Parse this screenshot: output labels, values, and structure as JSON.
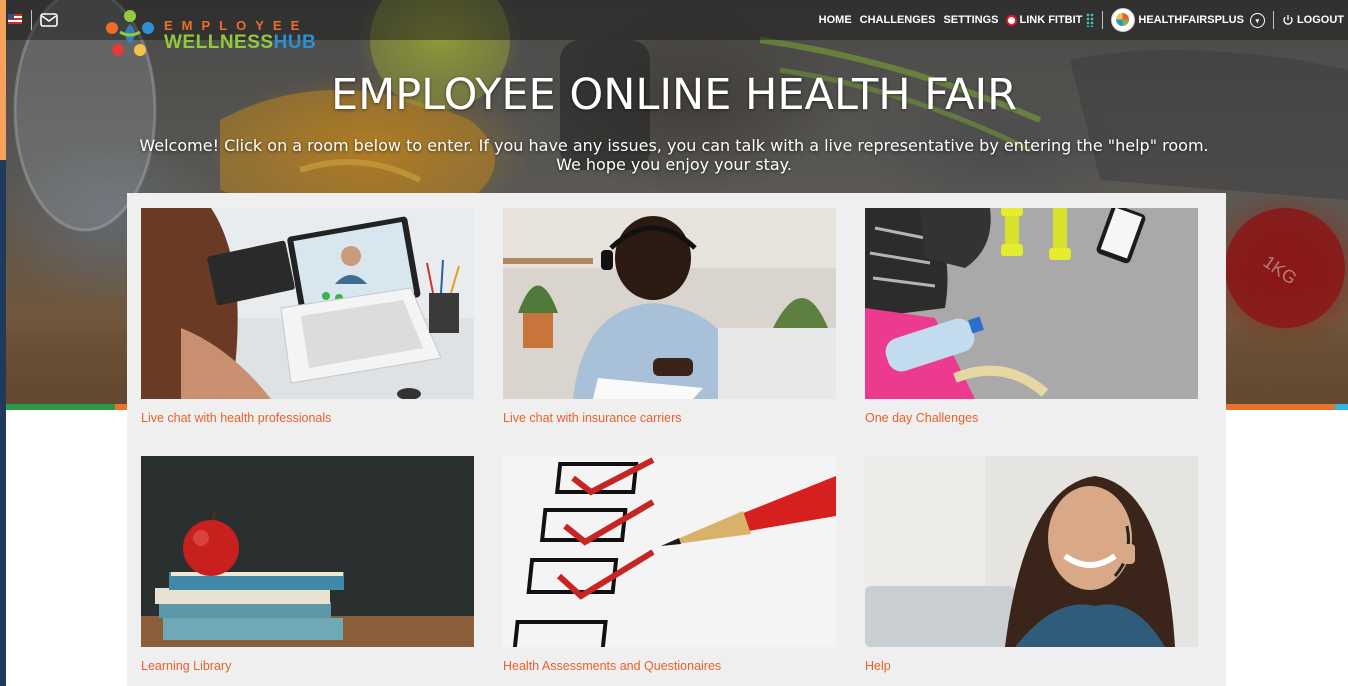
{
  "brand": {
    "line1": "EMPLOYEE",
    "line2a": "WELLNESS",
    "line2b": "HUB"
  },
  "nav": {
    "home": "HOME",
    "challenges": "CHALLENGES",
    "settings": "SETTINGS",
    "link_fitbit": "LINK FITBIT",
    "username": "HEALTHFAIRSPLUS",
    "logout": "LOGOUT"
  },
  "hero": {
    "title": "EMPLOYEE ONLINE HEALTH FAIR",
    "subtitle_line1": "Welcome!  Click on a room below to enter.  If you have any issues, you can talk with a live representative by entering the \"help\" room.",
    "subtitle_line2": "We hope you enjoy your stay."
  },
  "rooms": [
    {
      "label": "Live chat with health professionals",
      "image": "video-call-laptop"
    },
    {
      "label": "Live chat with insurance carriers",
      "image": "man-with-headset"
    },
    {
      "label": "One day Challenges",
      "image": "sneakers-dumbbells-water"
    },
    {
      "label": "Learning Library",
      "image": "apple-on-books"
    },
    {
      "label": "Health Assessments and Questionaires",
      "image": "checklist-red-pencil"
    },
    {
      "label": "Help",
      "image": "support-agent-headset"
    }
  ],
  "colors": {
    "accent": "#e8612c",
    "panel": "#efefef",
    "fitbit_ring": "#e21c24"
  }
}
